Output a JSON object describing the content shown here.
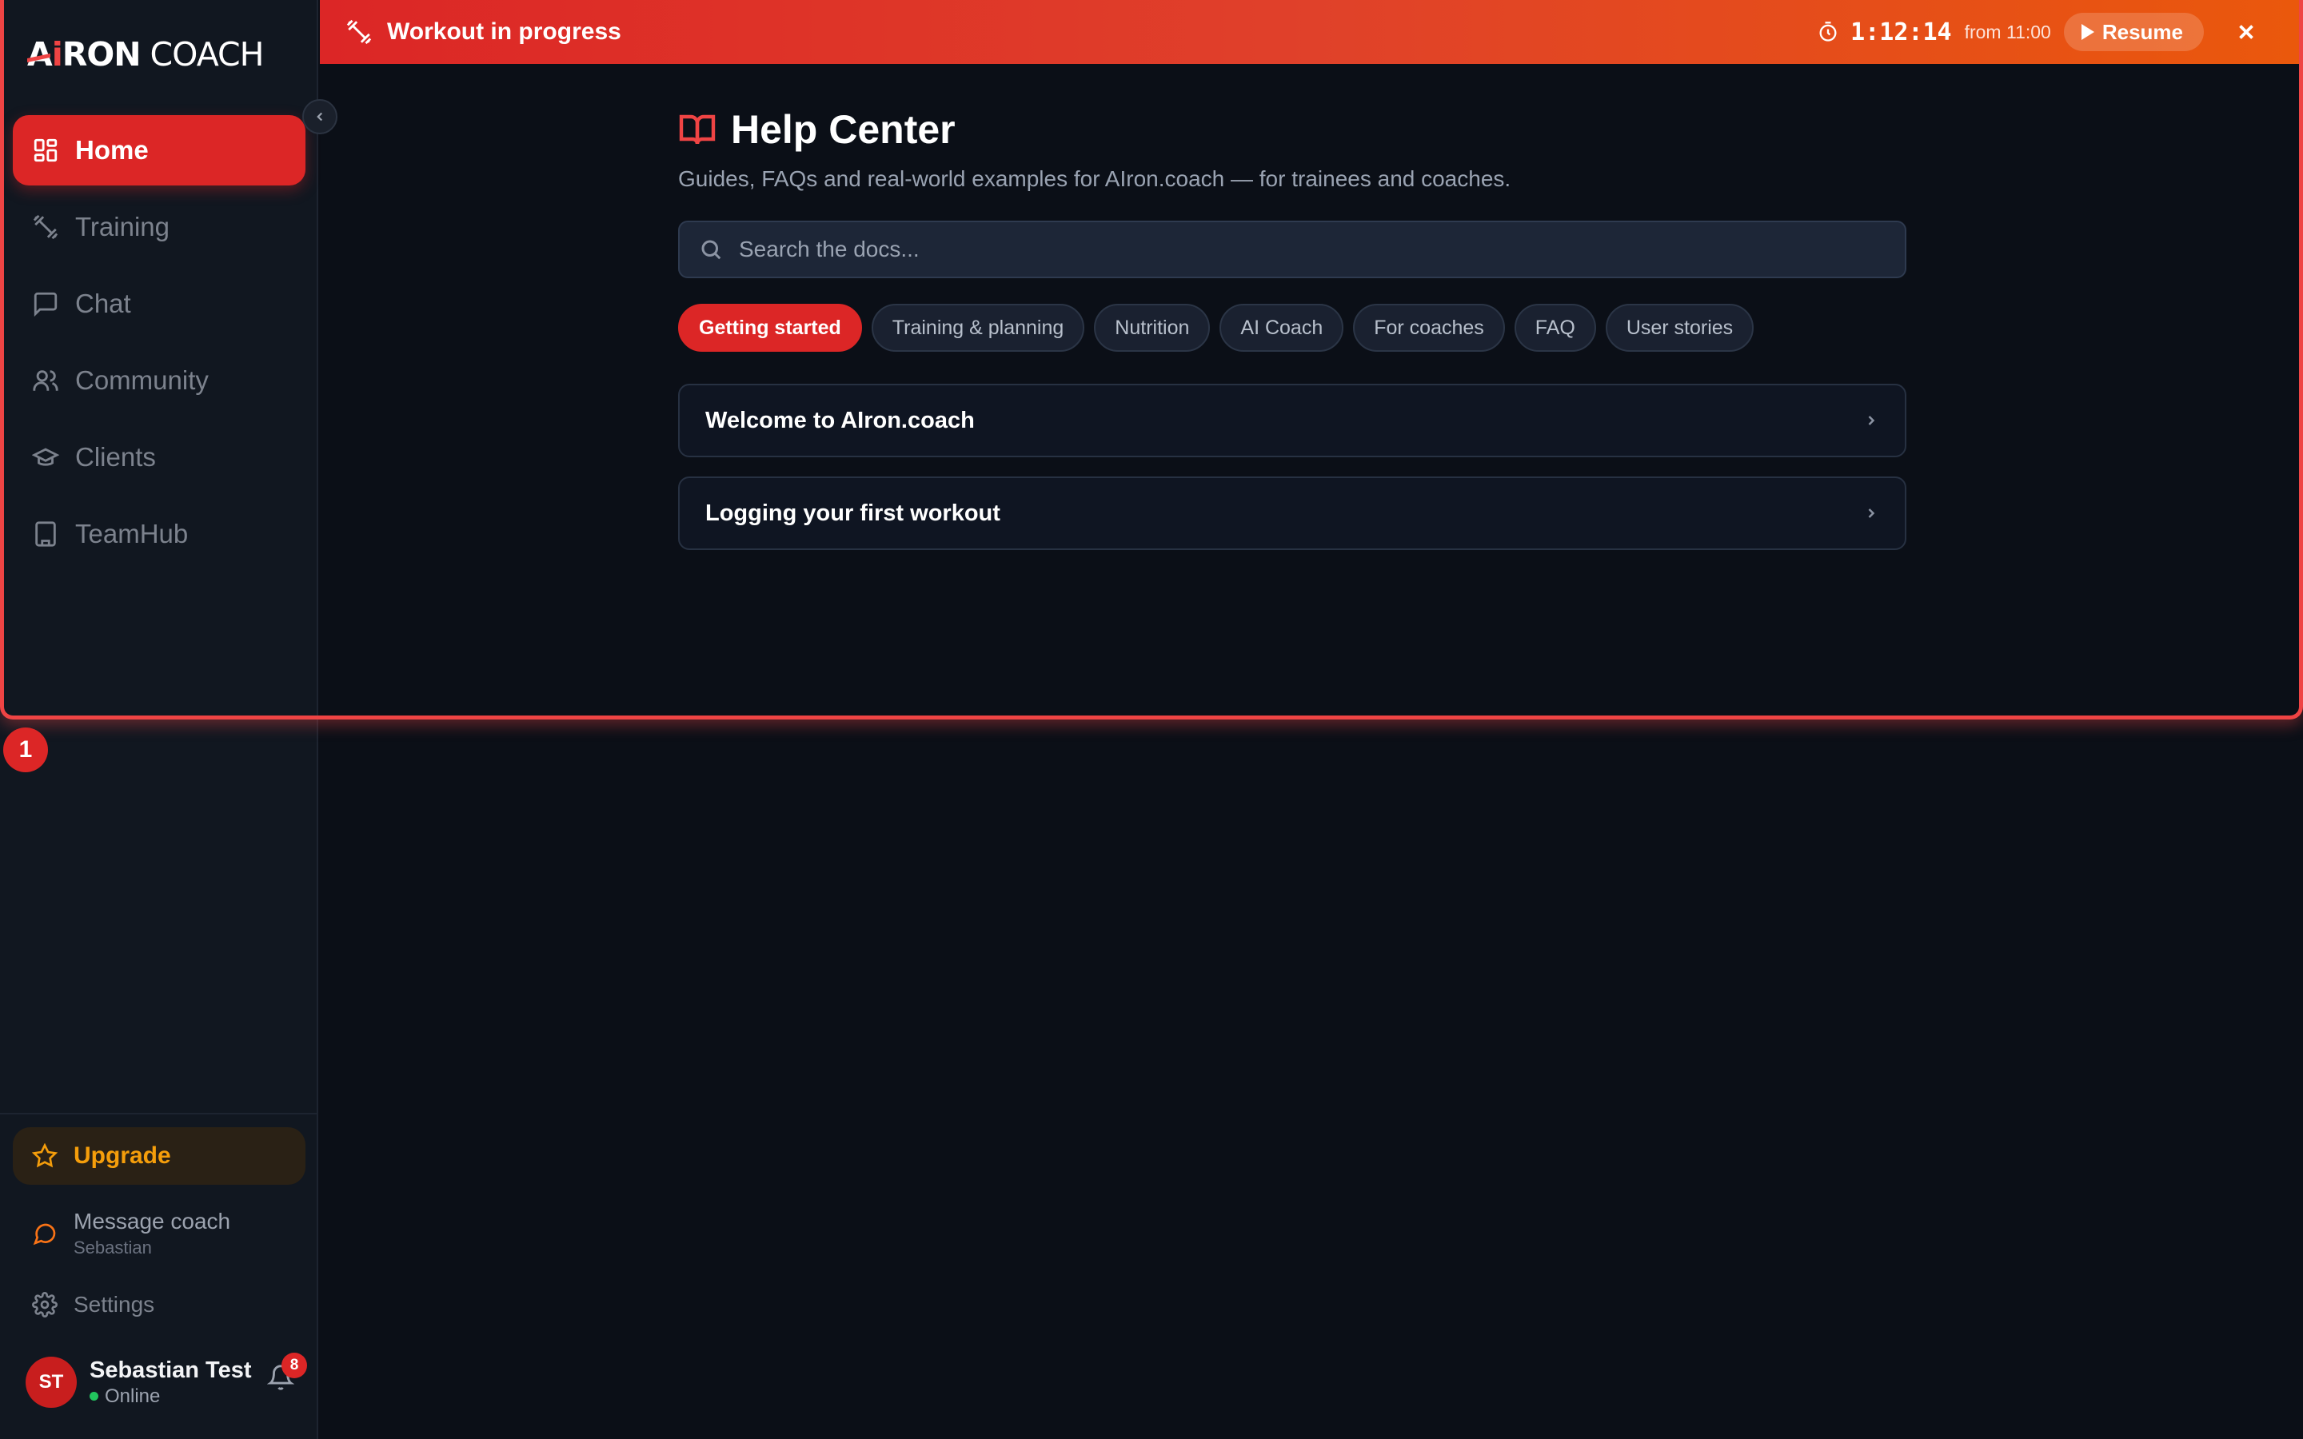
{
  "app": {
    "logo_a": "A",
    "logo_i": "i",
    "logo_ron": "RON",
    "logo_coach": "COACH"
  },
  "nav": {
    "items": [
      {
        "label": "Home",
        "icon": "grid-icon",
        "active": true
      },
      {
        "label": "Training",
        "icon": "dumbbell-icon",
        "active": false
      },
      {
        "label": "Chat",
        "icon": "chat-icon",
        "active": false
      },
      {
        "label": "Community",
        "icon": "users-icon",
        "active": false
      },
      {
        "label": "Clients",
        "icon": "graduation-cap-icon",
        "active": false
      },
      {
        "label": "TeamHub",
        "icon": "building-icon",
        "active": false
      }
    ]
  },
  "sidebar_bottom": {
    "upgrade": "Upgrade",
    "message_coach": "Message coach",
    "coach_name": "Sebastian",
    "settings": "Settings",
    "user_initials": "ST",
    "user_name": "Sebastian Test",
    "user_status": "Online",
    "notification_count": "8"
  },
  "topbar": {
    "title": "Workout in progress",
    "timer": "1:12:14",
    "from": "from 11:00",
    "resume": "Resume"
  },
  "help": {
    "title": "Help Center",
    "subtitle": "Guides, FAQs and real-world examples for AIron.coach — for trainees and coaches.",
    "search_placeholder": "Search the docs...",
    "categories": [
      {
        "label": "Getting started",
        "active": true
      },
      {
        "label": "Training & planning",
        "active": false
      },
      {
        "label": "Nutrition",
        "active": false
      },
      {
        "label": "AI Coach",
        "active": false
      },
      {
        "label": "For coaches",
        "active": false
      },
      {
        "label": "FAQ",
        "active": false
      },
      {
        "label": "User stories",
        "active": false
      }
    ],
    "articles": [
      {
        "title": "Welcome to AIron.coach"
      },
      {
        "title": "Logging your first workout"
      }
    ]
  },
  "overlay": {
    "step_number": "1",
    "highlight_color": "#ef4444"
  },
  "colors": {
    "accent": "#dc2626",
    "upgrade": "#f59e0b",
    "online": "#22c55e"
  }
}
